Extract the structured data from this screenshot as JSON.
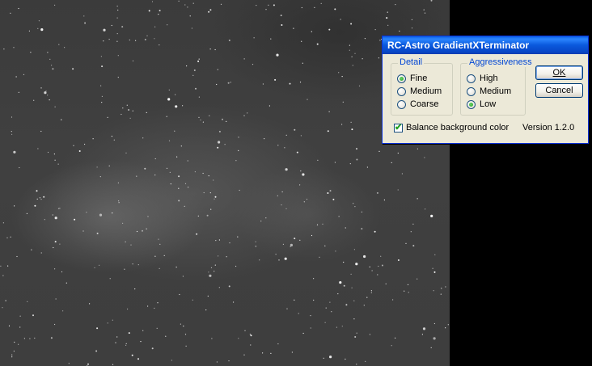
{
  "dialog": {
    "title": "RC-Astro GradientXTerminator",
    "detail": {
      "legend": "Detail",
      "options": [
        {
          "label": "Fine",
          "checked": true
        },
        {
          "label": "Medium",
          "checked": false
        },
        {
          "label": "Coarse",
          "checked": false
        }
      ]
    },
    "aggressiveness": {
      "legend": "Aggressiveness",
      "options": [
        {
          "label": "High",
          "checked": false
        },
        {
          "label": "Medium",
          "checked": false
        },
        {
          "label": "Low",
          "checked": true
        }
      ]
    },
    "ok_label": "OK",
    "cancel_label": "Cancel",
    "balance_label": "Balance background color",
    "balance_checked": true,
    "version": "Version 1.2.0"
  },
  "colors": {
    "title_bar": "#0a58dc",
    "dialog_face": "#ece9d8",
    "group_legend": "#0046d5",
    "image_background": "#3e3e3e"
  }
}
